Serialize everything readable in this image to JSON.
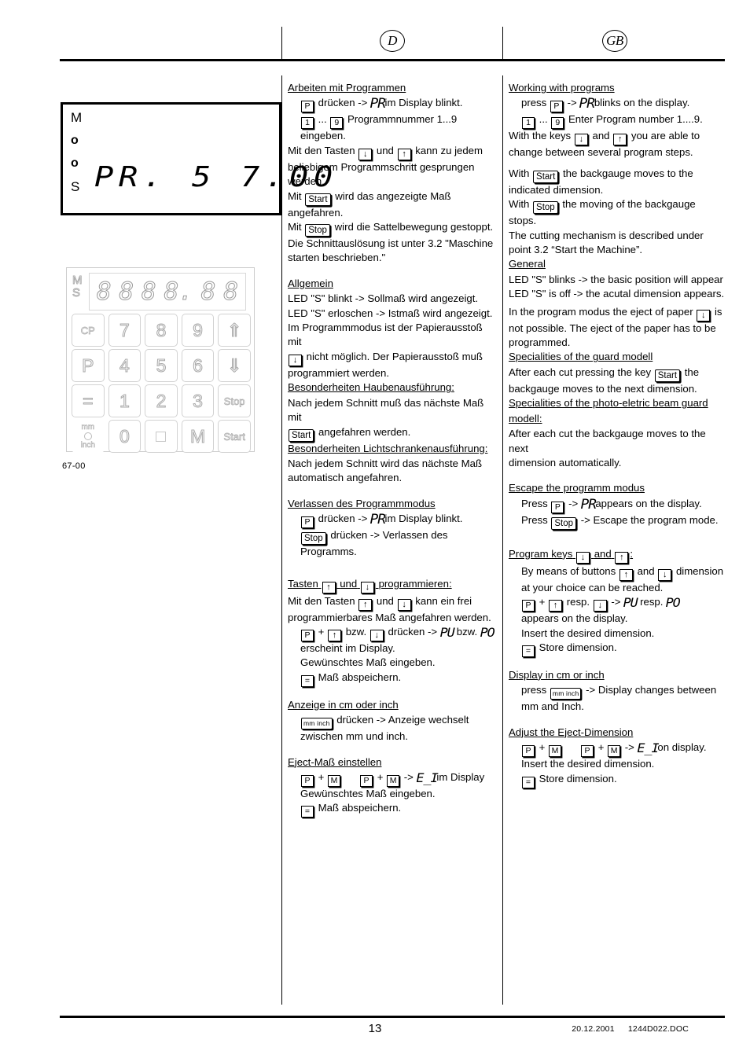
{
  "header": {
    "lang_de": "D",
    "lang_gb": "GB"
  },
  "figures": {
    "lcd": {
      "flags": [
        "M",
        "o",
        "o",
        "S"
      ],
      "value": "PR. 5 7.00"
    },
    "keypad": {
      "ms_labels": [
        "M",
        "S"
      ],
      "segments": [
        "8",
        "8",
        "8",
        "8.",
        "8",
        "8"
      ],
      "rows": [
        [
          "CP",
          "7",
          "8",
          "9",
          "⇑"
        ],
        [
          "P",
          "4",
          "5",
          "6",
          "⇓"
        ],
        [
          "=",
          "1",
          "2",
          "3",
          "Stop"
        ],
        [
          "mm inch",
          "0",
          "□",
          "M",
          "Start"
        ]
      ],
      "mm_label_top": "mm",
      "mm_label_bottom": "inch"
    },
    "caption": "67-00"
  },
  "german": {
    "s1_head": "Arbeiten mit Programmen",
    "s1_l1_a": "drücken ->",
    "s1_l1_seg": "PR",
    "s1_l1_b": "im Display blinkt.",
    "s1_l2_mid": "...",
    "s1_l2_b": "Programmnummer 1...9 eingeben.",
    "s1_l3_a": "Mit den Tasten",
    "s1_l3_b": "und",
    "s1_l3_c": "kann zu jedem",
    "s1_l4": "beliebigem Programmschritt gesprungen",
    "s1_l5": "werden.",
    "s1_l6_a": "Mit",
    "s1_l6_b": "wird das angezeigte Maß",
    "s1_l7": "angefahren.",
    "s1_l8_a": "Mit",
    "s1_l8_b": "wird die Sattelbewegung gestoppt.",
    "s1_l9": "Die Schnittauslösung ist unter 3.2 \"Maschine",
    "s1_l10": "starten beschrieben.\"",
    "s2_head": "Allgemein",
    "s2_l1": "LED \"S\" blinkt -> Sollmaß wird angezeigt.",
    "s2_l2": "LED \"S\" erloschen -> Istmaß wird angezeigt.",
    "s2_l3": "Im Programmmodus ist der Papierausstoß mit",
    "s2_l4_b": "nicht möglich. Der Papierausstoß muß",
    "s2_l5": "programmiert werden.",
    "s3_head": "Besonderheiten Haubenausführung:",
    "s3_l1": "Nach jedem Schnitt muß das nächste Maß mit",
    "s3_l2_b": "angefahren werden.",
    "s4_head": "Besonderheiten Lichtschrankenausführung:",
    "s4_l1": "Nach jedem Schnitt wird das nächste Maß",
    "s4_l2": "automatisch angefahren.",
    "s5_head": "Verlassen des Programmmodus",
    "s5_l1_a": "drücken ->",
    "s5_l1_seg": "PR",
    "s5_l1_b": "im Display blinkt.",
    "s5_l2_b": "drücken -> Verlassen des",
    "s5_l3": "Programms.",
    "s6_head_a": "Tasten",
    "s6_head_b": "und",
    "s6_head_c": "programmieren:",
    "s6_l1_a": "Mit den Tasten",
    "s6_l1_b": "und",
    "s6_l1_c": "kann ein frei",
    "s6_l2": "programmierbares Maß angefahren werden.",
    "s6_l3_plus": "+",
    "s6_l3_a": "bzw.",
    "s6_l3_b": "drücken ->",
    "s6_l3_seg1": "PU",
    "s6_l3_c": "bzw.",
    "s6_l3_seg2": "PO",
    "s6_l4": "erscheint im Display.",
    "s6_l5": "Gewünschtes Maß eingeben.",
    "s6_l6_b": "Maß abspeichern.",
    "s7_head": "Anzeige in cm oder inch",
    "s7_l1_b": "drücken -> Anzeige wechselt",
    "s7_l2": "zwischen mm und inch.",
    "s8_head": "Eject-Maß einstellen",
    "s8_l1_plus": "+",
    "s8_l1_arrow": "->",
    "s8_l1_seg": "E_I",
    "s8_l1_b": "im Display",
    "s8_l2": "Gewünschtes Maß eingeben.",
    "s8_l3_b": "Maß abspeichern."
  },
  "english": {
    "s1_head": "Working with programs",
    "s1_l1_a": "press",
    "s1_l1_arrow": "->",
    "s1_l1_seg": "PR",
    "s1_l1_b": "blinks on the display.",
    "s1_l2_mid": "...",
    "s1_l2_b": "Enter Program number 1....9.",
    "s1_l3_a": "With the keys",
    "s1_l3_b": "and",
    "s1_l3_c": "you are able to",
    "s1_l4": "change between several program steps.",
    "s1_l5_a": "With",
    "s1_l5_b": "the backgauge moves to the",
    "s1_l6": "indicated dimension.",
    "s1_l7_a": "With",
    "s1_l7_b": "the moving of the backgauge",
    "s1_l8": "stops.",
    "s1_l9": "The cutting mechanism is described under",
    "s1_l10": "point 3.2  “Start the Machine”.",
    "s2_head": "General",
    "s2_l1": "LED \"S\" blinks -> the basic position will appear",
    "s2_l2": "LED \"S\" is off -> the acutal dimension appears.",
    "s2_l3_a": "In the program modus the eject of paper",
    "s2_l3_b": "is",
    "s2_l4": "not possible. The eject of the paper has to be",
    "s2_l5": "programmed.",
    "s3_head": "Specialities of the guard modell",
    "s3_l1_a": "After each cut pressing the key",
    "s3_l1_b": "the",
    "s3_l2": "backgauge moves to the next dimension.",
    "s4_head_l1": "Specialities of the photo-eletric beam guard",
    "s4_head_l2": "modell:",
    "s4_l1": "After each cut the backgauge moves to the next",
    "s4_l2": "dimension automatically.",
    "s5_head": "Escape the programm modus",
    "s5_l1_a": "Press",
    "s5_l1_arrow": "->",
    "s5_l1_seg": "PR",
    "s5_l1_b": "appears on the display.",
    "s5_l2_a": "Press",
    "s5_l2_b": "-> Escape the program mode.",
    "s6_head_a": "Program keys",
    "s6_head_b": "and",
    "s6_head_c": ":",
    "s6_l1_a": "By means of buttons",
    "s6_l1_b": "and",
    "s6_l1_c": "dimension",
    "s6_l2": "at your choice can be reached.",
    "s6_l3_plus": "+",
    "s6_l3_a": "resp.",
    "s6_l3_arrow": "->",
    "s6_l3_seg1": "PU",
    "s6_l3_b": "resp.",
    "s6_l3_seg2": "PO",
    "s6_l4": "appears on the display.",
    "s6_l5": "Insert the desired dimension.",
    "s6_l6_b": "Store dimension.",
    "s7_head": "Display in cm or inch",
    "s7_l1_a": "press",
    "s7_l1_b": "-> Display changes between",
    "s7_l2": "mm and Inch.",
    "s8_head": "Adjust the Eject-Dimension",
    "s8_l1_plus": "+",
    "s8_l1_arrow": "->",
    "s8_l1_seg": "E_I",
    "s8_l1_b": "on display.",
    "s8_l2": "Insert the desired dimension.",
    "s8_l3_b": "Store dimension."
  },
  "keys": {
    "p": "P",
    "m": "M",
    "eq": "=",
    "one": "1",
    "nine": "9",
    "up": "↑",
    "down": "↓",
    "start": "Start",
    "stop": "Stop",
    "mminch": "mm inch"
  },
  "footer": {
    "page": "13",
    "date": "20.12.2001",
    "doc": "1244D022.DOC"
  }
}
